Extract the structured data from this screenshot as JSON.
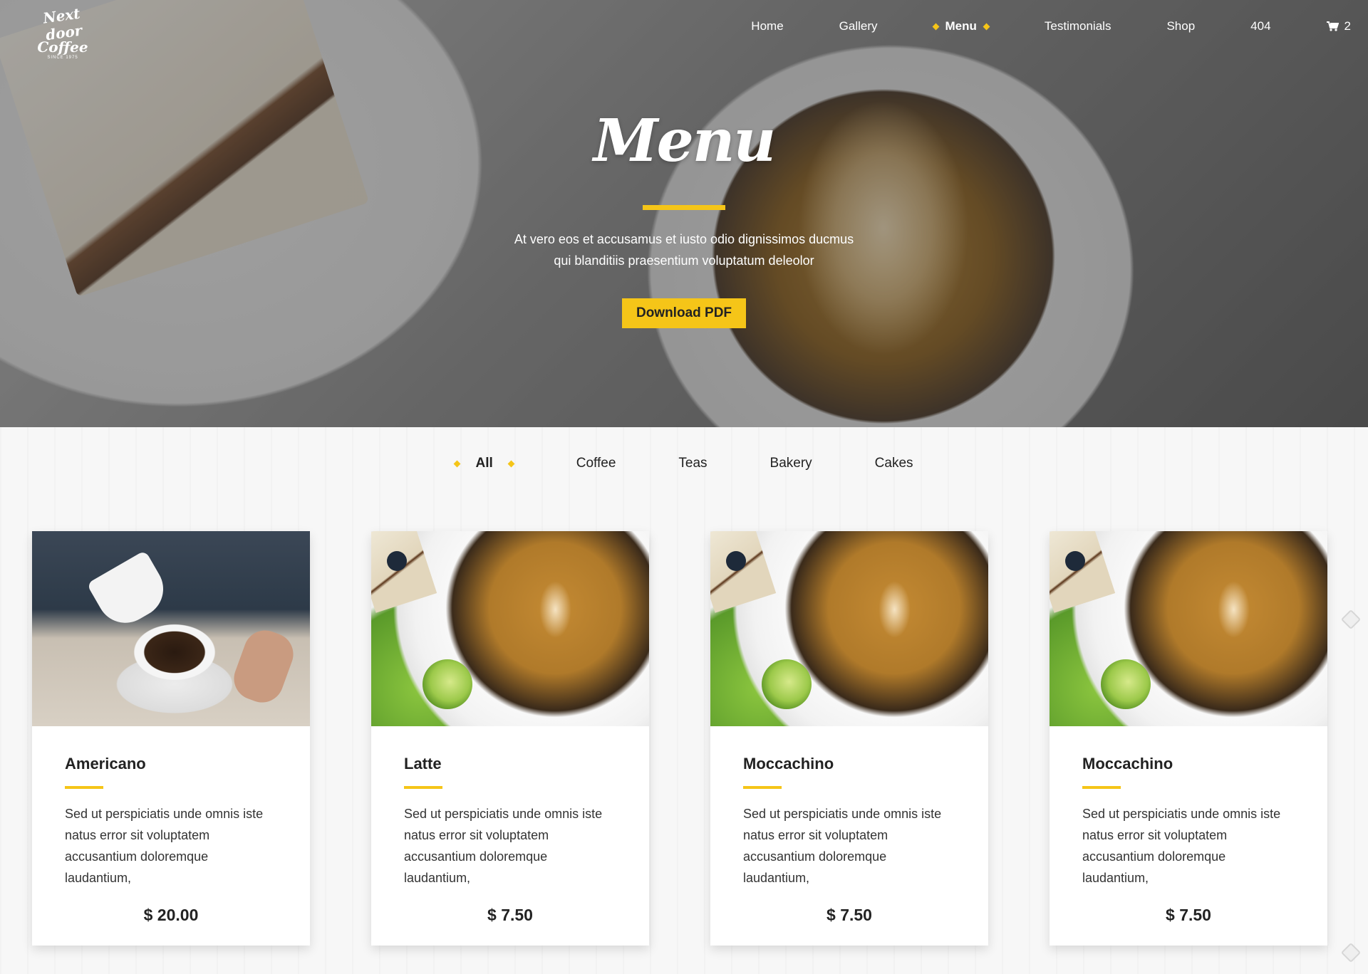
{
  "brand": {
    "line1": "Next door",
    "line2": "Coffee",
    "since": "SINCE 1975"
  },
  "nav": {
    "items": [
      {
        "label": "Home"
      },
      {
        "label": "Gallery"
      },
      {
        "label": "Menu"
      },
      {
        "label": "Testimonials"
      },
      {
        "label": "Shop"
      },
      {
        "label": "404"
      }
    ],
    "cart_count": "2",
    "cart_icon": "cart-icon"
  },
  "hero": {
    "title": "Menu",
    "subtitle_line1": "At vero eos et accusamus et iusto odio dignissimos ducmus",
    "subtitle_line2": "qui blanditiis praesentium voluptatum deleolor",
    "button": "Download PDF"
  },
  "filters": [
    "All",
    "Coffee",
    "Teas",
    "Bakery",
    "Cakes"
  ],
  "items": [
    {
      "name": "Americano",
      "description": "Sed ut perspiciatis unde omnis iste natus error sit voluptatem accusantium doloremque laudantium,",
      "price": "$ 20.00"
    },
    {
      "name": "Latte",
      "description": "Sed ut perspiciatis unde omnis iste natus error sit voluptatem accusantium doloremque laudantium,",
      "price": "$ 7.50"
    },
    {
      "name": "Moccachino",
      "description": "Sed ut perspiciatis unde omnis iste natus error sit voluptatem accusantium doloremque laudantium,",
      "price": "$ 7.50"
    },
    {
      "name": "Moccachino",
      "description": "Sed ut perspiciatis unde omnis iste natus error sit voluptatem accusantium doloremque laudantium,",
      "price": "$ 7.50"
    }
  ],
  "colors": {
    "accent": "#f5c518",
    "text": "#222222"
  }
}
